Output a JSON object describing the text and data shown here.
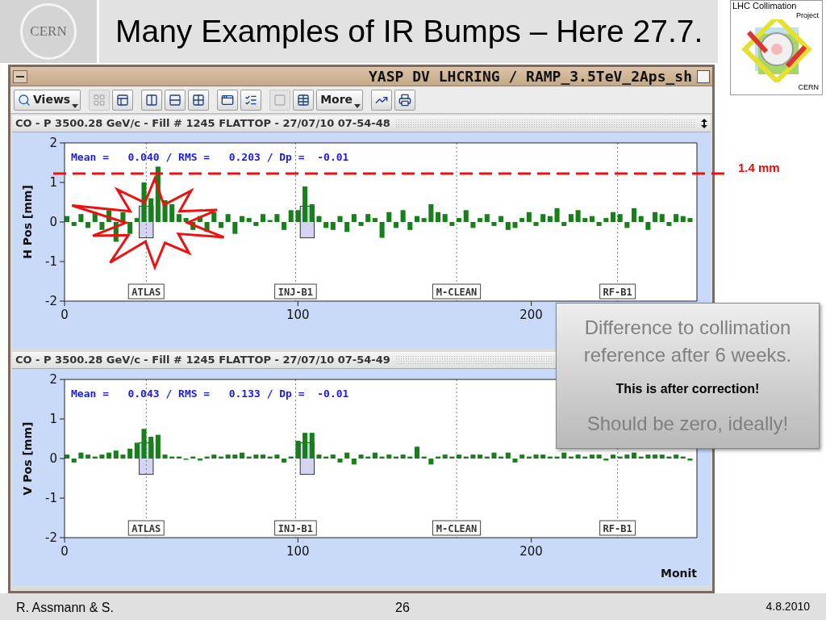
{
  "slide": {
    "title": "Many Examples of IR Bumps – Here 27.7.",
    "left_logo": "CERN",
    "right_logo": {
      "title": "LHC Collimation",
      "subtitle": "Project",
      "org": "CERN"
    }
  },
  "window": {
    "title": "YASP DV LHCRING / RAMP_3.5TeV_2Aps_sh",
    "toolbar": [
      {
        "kind": "dropdown",
        "label": "Views"
      },
      {
        "kind": "separator"
      },
      {
        "kind": "icon",
        "disabled": true
      },
      {
        "kind": "icon",
        "disabled": false
      },
      {
        "kind": "separator"
      },
      {
        "kind": "icon",
        "disabled": false
      },
      {
        "kind": "icon",
        "disabled": false
      },
      {
        "kind": "icon",
        "disabled": false
      },
      {
        "kind": "separator"
      },
      {
        "kind": "icon",
        "disabled": false
      },
      {
        "kind": "icon",
        "disabled": false
      },
      {
        "kind": "separator"
      },
      {
        "kind": "icon",
        "disabled": true
      },
      {
        "kind": "icon",
        "disabled": false
      },
      {
        "kind": "dropdown",
        "label": "More"
      },
      {
        "kind": "separator"
      },
      {
        "kind": "icon",
        "disabled": false
      },
      {
        "kind": "icon",
        "disabled": false
      }
    ],
    "panels": [
      {
        "header": "CO - P 3500.28 GeV/c - Fill # 1245 FLATTOP - 27/07/10 07-54-48",
        "resize_icon": true,
        "stats": "Mean =   0.040 / RMS =   0.203 / Dp =  -0.01",
        "chart_data": {
          "type": "bar",
          "ylabel": "H Pos [mm]",
          "xlim": [
            0,
            271
          ],
          "ylim": [
            -2,
            2
          ],
          "xticks": [
            0,
            100,
            200
          ],
          "yticks": [
            -2,
            -1,
            0,
            1,
            2
          ],
          "x": [
            0,
            3,
            6,
            9,
            12,
            15,
            18,
            21,
            24,
            27,
            30,
            33,
            36,
            39,
            42,
            45,
            48,
            51,
            54,
            57,
            60,
            63,
            66,
            69,
            72,
            75,
            78,
            81,
            84,
            87,
            90,
            93,
            96,
            99,
            102,
            105,
            108,
            111,
            114,
            117,
            120,
            123,
            126,
            129,
            132,
            135,
            138,
            141,
            144,
            147,
            150,
            153,
            156,
            159,
            162,
            165,
            168,
            171,
            174,
            177,
            180,
            183,
            186,
            189,
            192,
            195,
            198,
            201,
            204,
            207,
            210,
            213,
            216,
            219,
            222,
            225,
            228,
            231,
            234,
            237,
            240,
            243,
            246,
            249,
            252,
            255,
            258,
            261,
            264,
            267
          ],
          "values": [
            0.15,
            -0.1,
            0.2,
            -0.15,
            0.25,
            -0.2,
            0.3,
            -0.5,
            0.25,
            -0.3,
            0.1,
            1.0,
            0.6,
            1.4,
            0.55,
            0.45,
            0.2,
            0.1,
            -0.2,
            0.15,
            -0.25,
            0.25,
            -0.15,
            0.2,
            -0.3,
            0.15,
            0.1,
            -0.1,
            0.2,
            0.05,
            0.2,
            -0.2,
            0.3,
            0.3,
            0.9,
            0.45,
            0.15,
            -0.15,
            -0.2,
            0.15,
            -0.25,
            0.2,
            -0.1,
            0.2,
            0.1,
            -0.4,
            0.25,
            -0.15,
            0.3,
            -0.2,
            0.15,
            0.1,
            0.45,
            0.25,
            0.2,
            -0.1,
            0.1,
            0.3,
            -0.15,
            0.1,
            0.2,
            -0.1,
            0.15,
            -0.2,
            -0.15,
            0.1,
            0.25,
            -0.1,
            0.2,
            0.15,
            0.35,
            -0.1,
            0.2,
            0.3,
            0.1,
            0.15,
            -0.1,
            0.1,
            0.25,
            0.2,
            -0.15,
            0.35,
            0.15,
            -0.2,
            0.25,
            0.2,
            -0.1,
            0.2,
            0.15,
            0.1
          ],
          "ref_lines": [
            {
              "axis": "x",
              "value": 35,
              "label": "ATLAS"
            },
            {
              "axis": "x",
              "value": 99,
              "label": "INJ-B1"
            },
            {
              "axis": "x",
              "value": 168,
              "label": "M-CLEAN"
            },
            {
              "axis": "x",
              "value": 237,
              "label": "RF-B1"
            }
          ],
          "bands": [
            {
              "axis": "x",
              "from": 32,
              "to": 38
            },
            {
              "axis": "x",
              "from": 101,
              "to": 107
            }
          ]
        }
      },
      {
        "header": "CO - P 3500.28 GeV/c - Fill # 1245 FLATTOP - 27/07/10 07-54-49",
        "stats": "Mean =   0.043 / RMS =   0.133 / Dp =  -0.01",
        "chart_data": {
          "type": "bar",
          "ylabel": "V Pos [mm]",
          "xlabel": "Monit",
          "xlim": [
            0,
            271
          ],
          "ylim": [
            -2,
            2
          ],
          "xticks": [
            0,
            100,
            200
          ],
          "yticks": [
            -2,
            -1,
            0,
            1,
            2
          ],
          "x": [
            0,
            3,
            6,
            9,
            12,
            15,
            18,
            21,
            24,
            27,
            30,
            33,
            36,
            39,
            42,
            45,
            48,
            51,
            54,
            57,
            60,
            63,
            66,
            69,
            72,
            75,
            78,
            81,
            84,
            87,
            90,
            93,
            96,
            99,
            102,
            105,
            108,
            111,
            114,
            117,
            120,
            123,
            126,
            129,
            132,
            135,
            138,
            141,
            144,
            147,
            150,
            153,
            156,
            159,
            162,
            165,
            168,
            171,
            174,
            177,
            180,
            183,
            186,
            189,
            192,
            195,
            198,
            201,
            204,
            207,
            210,
            213,
            216,
            219,
            222,
            225,
            228,
            231,
            234,
            237,
            240,
            243,
            246,
            249,
            252,
            255,
            258,
            261,
            264,
            267
          ],
          "values": [
            0.1,
            -0.1,
            0.15,
            0.1,
            0.05,
            0.1,
            0.15,
            0.2,
            0.1,
            0.25,
            0.4,
            0.75,
            0.55,
            0.6,
            0.1,
            0.05,
            0.05,
            0.0,
            0.05,
            -0.05,
            0.05,
            0.1,
            0.05,
            0.1,
            0.1,
            0.15,
            0.05,
            0.1,
            0.1,
            0.05,
            0.1,
            -0.1,
            0.05,
            0.45,
            0.65,
            0.65,
            0.1,
            0.05,
            0.1,
            -0.1,
            0.15,
            -0.15,
            0.1,
            0.05,
            0.15,
            0.05,
            0.1,
            0.05,
            0.1,
            0.05,
            0.3,
            0.05,
            -0.15,
            0.05,
            0.1,
            0.05,
            0.1,
            0.05,
            0.1,
            0.1,
            0.05,
            0.15,
            0.05,
            0.15,
            -0.1,
            0.1,
            0.05,
            0.1,
            0.1,
            0.05,
            0.05,
            0.15,
            0.05,
            0.1,
            0.05,
            0.1,
            0.1,
            -0.05,
            0.1,
            0.05,
            0.1,
            0.15,
            0.05,
            0.1,
            0.1,
            0.1,
            0.05,
            0.1,
            0.05,
            -0.05
          ],
          "ref_lines": [
            {
              "axis": "x",
              "value": 35,
              "label": "ATLAS"
            },
            {
              "axis": "x",
              "value": 99,
              "label": "INJ-B1"
            },
            {
              "axis": "x",
              "value": 168,
              "label": "M-CLEAN"
            },
            {
              "axis": "x",
              "value": 237,
              "label": "RF-B1"
            }
          ],
          "bands": [
            {
              "axis": "x",
              "from": 32,
              "to": 38
            },
            {
              "axis": "x",
              "from": 101,
              "to": 107
            }
          ]
        }
      }
    ]
  },
  "threshold": {
    "label": "1.4 mm"
  },
  "callout": {
    "lines": [
      {
        "kind": "note",
        "text": "Difference to collimation reference after 6 weeks."
      },
      {
        "kind": "emphasis",
        "text": "This is after correction!"
      },
      {
        "kind": "note",
        "text": "Should be zero, ideally!"
      }
    ]
  },
  "footer": {
    "author": "R. Assmann & S.",
    "page": "26",
    "date": "4.8.2010"
  }
}
